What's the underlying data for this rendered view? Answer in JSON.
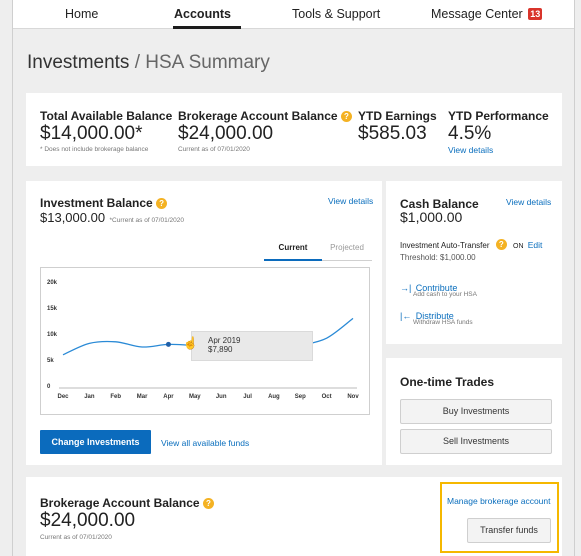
{
  "nav": {
    "home": "Home",
    "accounts": "Accounts",
    "tools": "Tools & Support",
    "messages": "Message Center",
    "messages_count": "13"
  },
  "page": {
    "section": "Investments",
    "separator": "/",
    "title": "HSA Summary"
  },
  "summary": {
    "total_label": "Total Available Balance",
    "total_value": "$14,000.00*",
    "total_note": "* Does not include brokerage balance",
    "brokerage_label": "Brokerage Account Balance",
    "brokerage_value": "$24,000.00",
    "brokerage_note": "Current as of 07/01/2020",
    "ytd_earnings_label": "YTD Earnings",
    "ytd_earnings_value": "$585.03",
    "ytd_perf_label": "YTD Performance",
    "ytd_perf_value": "4.5%",
    "ytd_perf_link": "View details"
  },
  "investment": {
    "label": "Investment Balance",
    "value": "$13,000.00",
    "note": "*Current as of 07/01/2020",
    "view_details": "View details",
    "tab_current": "Current",
    "tab_projected": "Projected",
    "change_button": "Change Investments",
    "view_funds": "View all available funds"
  },
  "chart_data": {
    "type": "line",
    "x": [
      "Dec",
      "Jan",
      "Feb",
      "Mar",
      "Apr",
      "May",
      "Jun",
      "Jul",
      "Aug",
      "Sep",
      "Oct",
      "Nov"
    ],
    "series": [
      {
        "values": [
          6000,
          8200,
          8500,
          7500,
          8000,
          7800,
          7800,
          7800,
          6800,
          7800,
          9200,
          13000
        ]
      }
    ],
    "yticks": [
      "0",
      "5k",
      "10k",
      "15k",
      "20k"
    ],
    "ylim": [
      0,
      20000
    ],
    "tooltip": {
      "date": "Apr 2019",
      "value": "$7,890"
    },
    "grid": false
  },
  "cash": {
    "label": "Cash Balance",
    "view_details": "View details",
    "value": "$1,000.00",
    "auto_transfer_label": "Investment Auto-Transfer",
    "auto_transfer_state": "ON",
    "edit": "Edit",
    "threshold": "Threshold: $1,000.00",
    "contribute_arrow": "→|",
    "contribute": "Contribute",
    "contribute_sub": "Add cash to your HSA",
    "distribute_arrow": "|←",
    "distribute": "Distribute",
    "distribute_sub": "Withdraw HSA funds"
  },
  "trades": {
    "label": "One-time Trades",
    "buy": "Buy Investments",
    "sell": "Sell Investments"
  },
  "brokerage": {
    "label": "Brokerage Account Balance",
    "value": "$24,000.00",
    "note": "Current as of 07/01/2020",
    "manage_link": "Manage brokerage account",
    "transfer_button": "Transfer funds"
  },
  "colors": {
    "accent": "#0b6bbd",
    "highlight": "#f5b800",
    "line": "#2a8ad6",
    "badge": "#d9342b"
  }
}
